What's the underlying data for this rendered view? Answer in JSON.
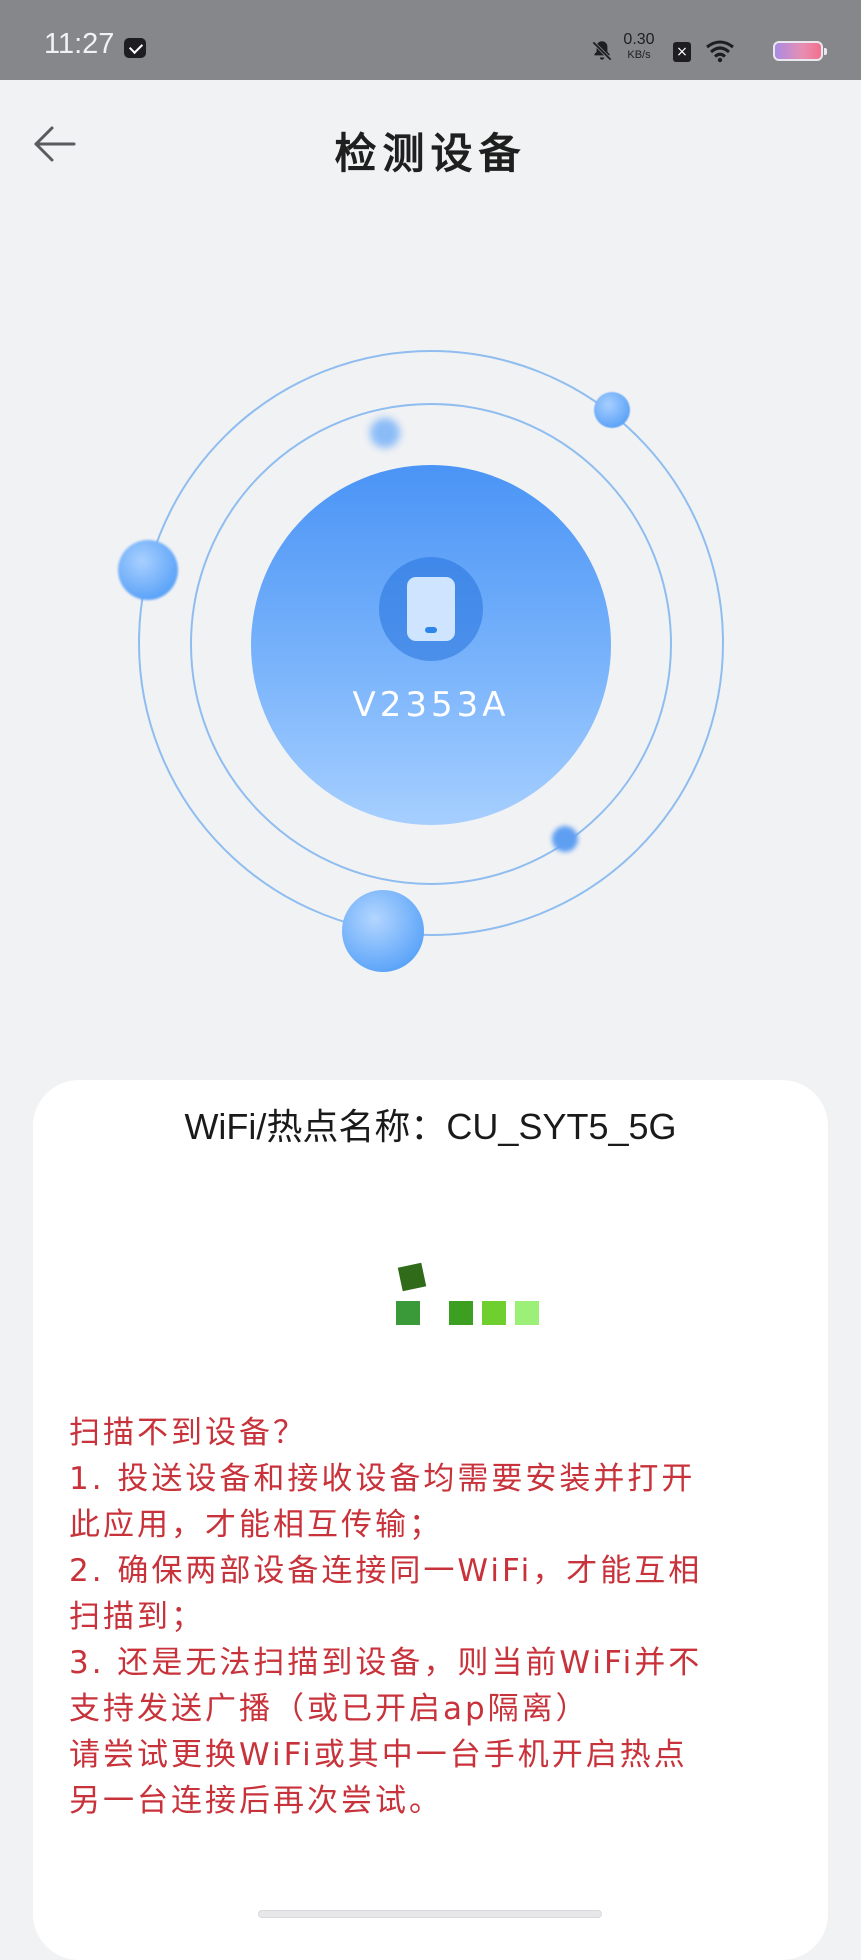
{
  "status_bar": {
    "time": "11:27",
    "net_speed_value": "0.30",
    "net_speed_unit": "KB/s",
    "icons": [
      "message-icon",
      "mute-bell-icon",
      "no-sim-icon",
      "wifi-icon",
      "battery-icon"
    ]
  },
  "header": {
    "title": "检测设备",
    "back_icon": "arrow-left-icon"
  },
  "radar": {
    "device_name": "V2353A",
    "device_icon": "phone-icon",
    "accent_color": "#4a94f6"
  },
  "card": {
    "wifi_line": "WiFi/热点名称：CU_SYT5_5G",
    "loading_icon": "loading-squares-icon",
    "help_color": "#c8323a",
    "help_lines": [
      "扫描不到设备？",
      " 1. 投送设备和接收设备均需要安装并打开",
      "此应用，才能相互传输；",
      " 2. 确保两部设备连接同一WiFi，才能互相",
      "扫描到；",
      " 3. 还是无法扫描到设备，则当前WiFi并不",
      "支持发送广播（或已开启ap隔离）",
      "请尝试更换WiFi或其中一台手机开启热点",
      "另一台连接后再次尝试。"
    ]
  }
}
